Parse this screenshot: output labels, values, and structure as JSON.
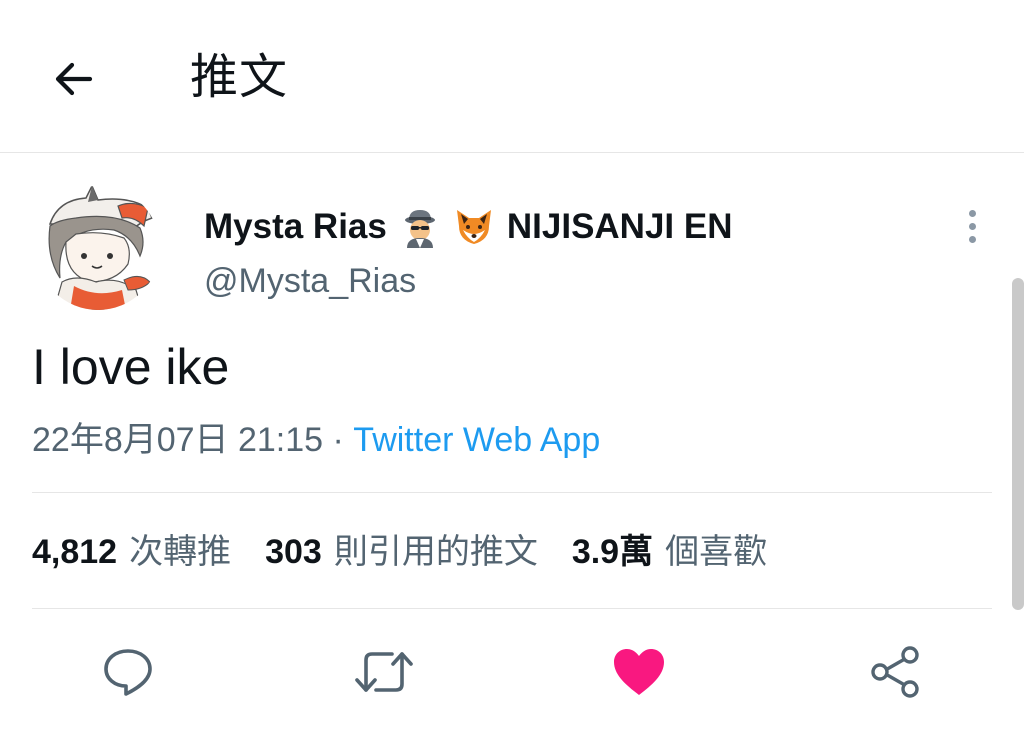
{
  "header": {
    "title": "推文",
    "back_icon": "arrow-left-icon"
  },
  "tweet": {
    "author": {
      "display_name": "Mysta Rias",
      "emojis": [
        "detective-emoji",
        "fox-emoji"
      ],
      "affiliation": "NIJISANJI EN",
      "handle": "@Mysta_Rias",
      "avatar": "avatar-image"
    },
    "text": "I love ike",
    "timestamp": "22年8月07日 21:15",
    "separator": " · ",
    "source": "Twitter Web App",
    "stats": {
      "retweets_count": "4,812",
      "retweets_label": "次轉推",
      "quotes_count": "303",
      "quotes_label": "則引用的推文",
      "likes_count": "3.9萬",
      "likes_label": "個喜歡"
    }
  },
  "actions": {
    "reply_icon": "reply-icon",
    "retweet_icon": "retweet-icon",
    "like_icon": "heart-icon",
    "share_icon": "share-icon",
    "like_color": "#f91880"
  },
  "colors": {
    "text_primary": "#0f1419",
    "text_secondary": "#536471",
    "link": "#1d9bf0",
    "divider": "#e6e6e6"
  }
}
